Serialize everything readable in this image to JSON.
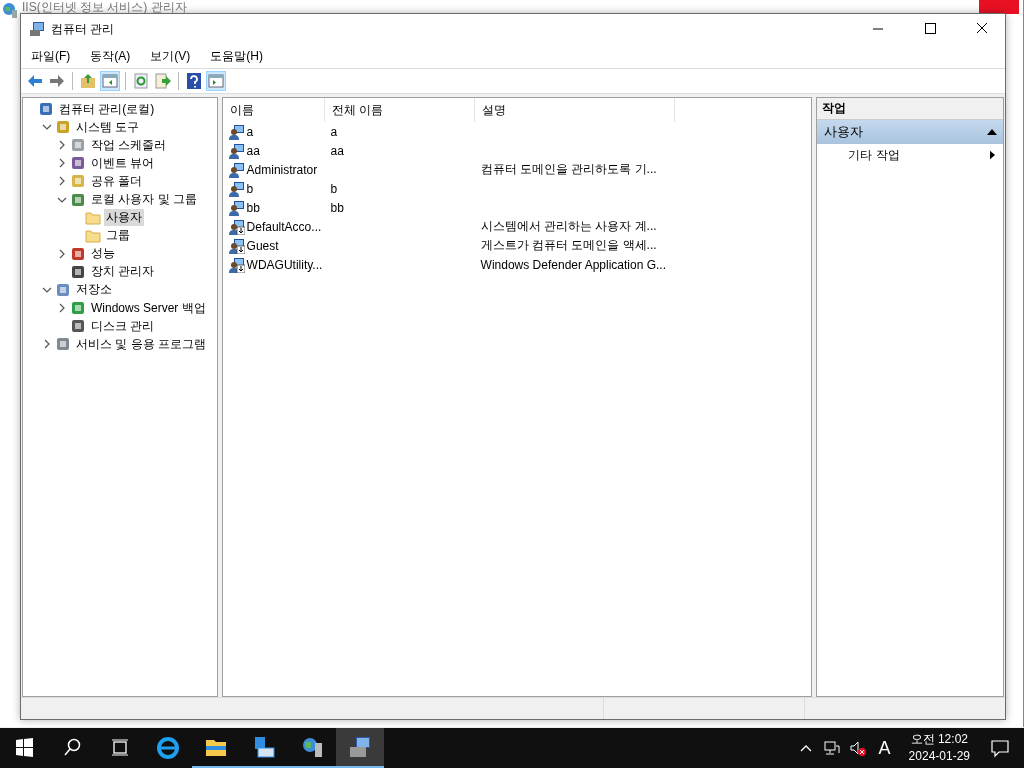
{
  "background_window": {
    "title": "IIS(인터넷 정보 서비스) 관리자"
  },
  "window": {
    "title": "컴퓨터 관리"
  },
  "menu": [
    "파일(F)",
    "동작(A)",
    "보기(V)",
    "도움말(H)"
  ],
  "toolbar": [
    {
      "kind": "back",
      "pressed": false
    },
    {
      "kind": "forward",
      "pressed": false
    },
    {
      "kind": "sep"
    },
    {
      "kind": "up",
      "pressed": false
    },
    {
      "kind": "tree",
      "pressed": true
    },
    {
      "kind": "sep"
    },
    {
      "kind": "refresh",
      "pressed": false
    },
    {
      "kind": "export",
      "pressed": false
    },
    {
      "kind": "sep"
    },
    {
      "kind": "help",
      "pressed": false
    },
    {
      "kind": "pane",
      "pressed": true
    }
  ],
  "tree": [
    {
      "label": "컴퓨터 관리(로컬)",
      "kind": "computer",
      "selected": false,
      "children": [
        {
          "label": "시스템 도구",
          "kind": "tools",
          "selected": false,
          "expanded": true,
          "children": [
            {
              "label": "작업 스케줄러",
              "kind": "clock",
              "selected": false,
              "expanded": false
            },
            {
              "label": "이벤트 뷰어",
              "kind": "event",
              "selected": false,
              "expanded": false
            },
            {
              "label": "공유 폴더",
              "kind": "share",
              "selected": false,
              "expanded": false
            },
            {
              "label": "로컬 사용자 및 그룹",
              "kind": "users",
              "selected": false,
              "expanded": true,
              "children": [
                {
                  "label": "사용자",
                  "kind": "folder",
                  "selected": true
                },
                {
                  "label": "그룹",
                  "kind": "folder",
                  "selected": false
                }
              ]
            },
            {
              "label": "성능",
              "kind": "performance",
              "selected": false,
              "expanded": false
            },
            {
              "label": "장치 관리자",
              "kind": "device",
              "selected": false
            }
          ]
        },
        {
          "label": "저장소",
          "kind": "storage",
          "selected": false,
          "expanded": true,
          "children": [
            {
              "label": "Windows Server 백업",
              "kind": "backup",
              "selected": false,
              "expanded": false
            },
            {
              "label": "디스크 관리",
              "kind": "disk",
              "selected": false
            }
          ]
        },
        {
          "label": "서비스 및 응용 프로그램",
          "kind": "services",
          "selected": false,
          "expanded": false
        }
      ]
    }
  ],
  "table": {
    "columns": [
      "이름",
      "전체 이름",
      "설명"
    ],
    "rows": [
      {
        "name": "a",
        "full_name": "a",
        "description": "",
        "disabled": false
      },
      {
        "name": "aa",
        "full_name": "aa",
        "description": "",
        "disabled": false
      },
      {
        "name": "Administrator",
        "full_name": "",
        "description": "컴퓨터 도메인을 관리하도록 기...",
        "disabled": false
      },
      {
        "name": "b",
        "full_name": "b",
        "description": "",
        "disabled": false
      },
      {
        "name": "bb",
        "full_name": "bb",
        "description": "",
        "disabled": false
      },
      {
        "name": "DefaultAcco...",
        "full_name": "",
        "description": "시스템에서 관리하는 사용자 계...",
        "disabled": true
      },
      {
        "name": "Guest",
        "full_name": "",
        "description": "게스트가 컴퓨터 도메인을 액세...",
        "disabled": true
      },
      {
        "name": "WDAGUtility...",
        "full_name": "",
        "description": "Windows Defender Application G...",
        "disabled": true
      }
    ]
  },
  "actions": {
    "title": "작업",
    "section": {
      "label": "사용자",
      "expanded": true
    },
    "items": [
      {
        "label": "기타 작업",
        "submenu": true
      }
    ]
  },
  "taskbar": {
    "apps": [
      {
        "kind": "ie",
        "running": false,
        "active": false
      },
      {
        "kind": "explorer",
        "running": true,
        "active": false
      },
      {
        "kind": "server",
        "running": true,
        "active": false
      },
      {
        "kind": "iis",
        "running": true,
        "active": false
      },
      {
        "kind": "compmgmt",
        "running": true,
        "active": true
      }
    ],
    "ime": "A",
    "time": "오전 12:02",
    "date": "2024-01-29"
  }
}
